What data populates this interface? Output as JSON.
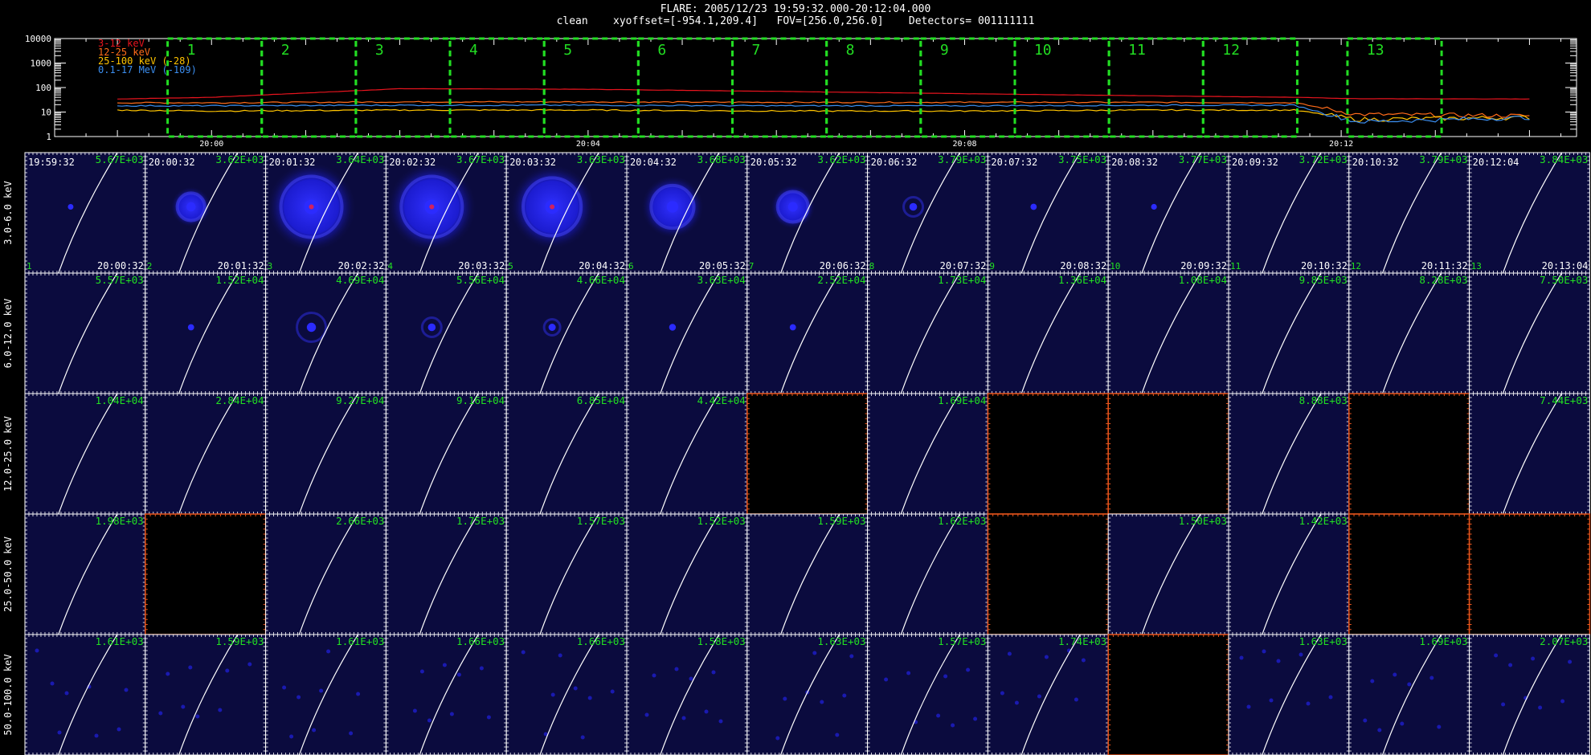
{
  "header": {
    "line1": "FLARE: 2005/12/23 19:59:32.000-20:12:04.000",
    "line2": "clean    xyoffset=[-954.1,209.4]   FOV=[256.0,256.0]    Detectors= 001111111"
  },
  "lightcurve": {
    "yticks": [
      "10000",
      "1000",
      "100",
      "10",
      "1"
    ],
    "xticks": [
      "20:00",
      "20:04",
      "20:08",
      "20:12"
    ],
    "legend": [
      {
        "label": "3-12 keV",
        "color": "#e8141e"
      },
      {
        "label": "12-25 keV",
        "color": "#ff6b1a"
      },
      {
        "label": "25-100 keV (-28)",
        "color": "#ffc400"
      },
      {
        "label": "0.1-17 MeV (-109)",
        "color": "#3b8ef0"
      }
    ],
    "interval_labels": [
      "1",
      "2",
      "3",
      "4",
      "5",
      "6",
      "7",
      "8",
      "9",
      "10",
      "11",
      "12",
      "13"
    ]
  },
  "chart_data": {
    "type": "line",
    "title": "FLARE: 2005/12/23 19:59:32.000-20:12:04.000",
    "ylabel": "",
    "xlabel": "",
    "yscale": "log",
    "ylim": [
      1,
      10000
    ],
    "x": [
      "19:59",
      "20:00",
      "20:02",
      "20:04",
      "20:06",
      "20:08",
      "20:10",
      "20:11:30",
      "20:12:10",
      "20:14"
    ],
    "series": [
      {
        "name": "3-12 keV",
        "color": "#e8141e",
        "values": [
          34,
          40,
          90,
          85,
          70,
          56,
          46,
          40,
          35,
          34
        ]
      },
      {
        "name": "12-25 keV",
        "color": "#ff6b1a",
        "values": [
          24,
          24,
          26,
          26,
          25,
          25,
          25,
          24,
          8,
          7
        ]
      },
      {
        "name": "25-100 keV (-28)",
        "color": "#ffc400",
        "values": [
          12,
          11,
          12,
          12,
          11,
          11,
          12,
          12,
          5,
          6
        ]
      },
      {
        "name": "0.1-17 MeV (-109)",
        "color": "#3b8ef0",
        "values": [
          18,
          18,
          19,
          19,
          18,
          18,
          19,
          19,
          4,
          6
        ]
      }
    ]
  },
  "grid": {
    "rows": [
      "3.0-6.0 keV",
      "6.0-12.0 keV",
      "12.0-25.0 keV",
      "25.0-50.0 keV",
      "50.0-100.0 keV"
    ],
    "start_times": [
      "19:59:32",
      "20:00:32",
      "20:01:32",
      "20:02:32",
      "20:03:32",
      "20:04:32",
      "20:05:32",
      "20:06:32",
      "20:07:32",
      "20:08:32",
      "20:09:32",
      "20:10:32",
      "20:12:04"
    ],
    "end_times": [
      "20:00:32",
      "20:01:32",
      "20:02:32",
      "20:03:32",
      "20:04:32",
      "20:05:32",
      "20:06:32",
      "20:07:32",
      "20:08:32",
      "20:09:32",
      "20:10:32",
      "20:11:32",
      "20:13:04"
    ],
    "panel_numbers": [
      "1",
      "2",
      "3",
      "4",
      "5",
      "6",
      "7",
      "8",
      "9",
      "10",
      "11",
      "12",
      "13"
    ],
    "max_values": [
      [
        "5.67E+03",
        "3.62E+03",
        "3.64E+03",
        "3.67E+03",
        "3.63E+03",
        "3.68E+03",
        "3.62E+03",
        "3.79E+03",
        "3.75E+03",
        "3.77E+03",
        "3.72E+03",
        "3.79E+03",
        "3.84E+03"
      ],
      [
        "5.57E+03",
        "1.52E+04",
        "4.69E+04",
        "5.56E+04",
        "4.66E+04",
        "3.63E+04",
        "2.52E+04",
        "1.73E+04",
        "1.36E+04",
        "1.08E+04",
        "9.85E+03",
        "8.28E+03",
        "7.50E+03"
      ],
      [
        "1.04E+04",
        "2.84E+04",
        "9.27E+04",
        "9.16E+04",
        "6.85E+04",
        "4.42E+04",
        "",
        "1.69E+04",
        "",
        "",
        "8.88E+03",
        "",
        "7.44E+03"
      ],
      [
        "1.98E+03",
        "",
        "2.66E+03",
        "1.75E+03",
        "1.57E+03",
        "1.52E+03",
        "1.59E+03",
        "1.62E+03",
        "",
        "1.50E+03",
        "1.42E+03",
        "",
        ""
      ],
      [
        "1.61E+03",
        "1.59E+03",
        "1.61E+03",
        "1.66E+03",
        "1.66E+03",
        "1.58E+03",
        "1.63E+03",
        "1.57E+03",
        "1.74E+03",
        "",
        "1.63E+03",
        "1.69E+03",
        "2.07E+03"
      ]
    ],
    "source_level": [
      [
        0.08,
        0.45,
        1,
        1,
        0.95,
        0.7,
        0.5,
        0.3,
        0.15,
        0.1,
        0,
        0,
        0
      ],
      [
        0,
        0.15,
        0.45,
        0.3,
        0.25,
        0.2,
        0.15,
        0,
        0,
        0,
        0,
        0,
        0
      ],
      [
        0,
        0,
        0,
        0,
        0,
        0,
        0,
        0,
        0,
        0,
        0,
        0,
        0
      ],
      [
        0,
        0,
        0,
        0,
        0,
        0,
        0,
        0,
        0,
        0,
        0,
        0,
        0
      ],
      [
        0,
        0,
        0,
        0,
        0,
        0,
        0,
        0,
        0,
        0,
        0,
        0,
        0
      ]
    ],
    "colors": {
      "panel_bg": "#0b0b3e",
      "empty_bg": "#000000",
      "empty_axis": "#e8541c",
      "value_text": "#22e022",
      "limb": "#ffffff",
      "interval_box": "#22dd22"
    }
  }
}
